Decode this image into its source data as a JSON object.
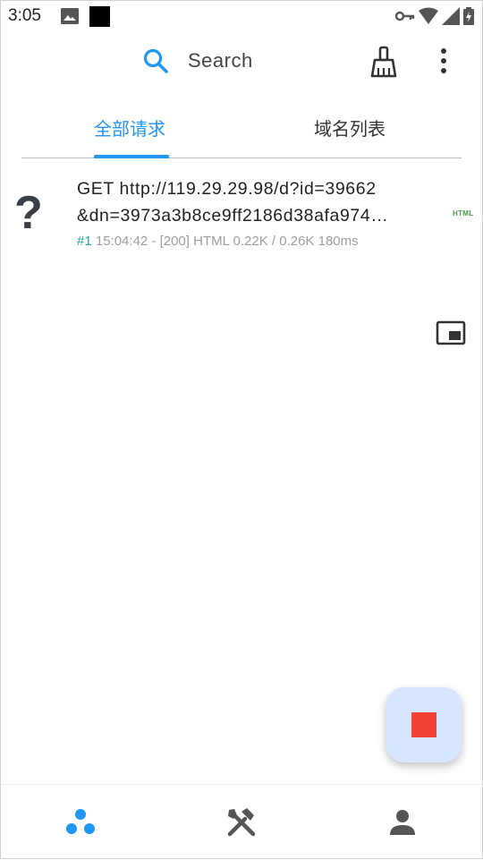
{
  "status_bar": {
    "time": "3:05",
    "icons": [
      "photo-icon",
      "black-square",
      "vpn-key-icon",
      "wifi-icon",
      "signal-icon",
      "battery-icon"
    ]
  },
  "toolbar": {
    "search_placeholder": "Search",
    "icons": [
      "search-icon",
      "broom-icon",
      "more-vert-icon"
    ]
  },
  "tabs": [
    {
      "label": "全部请求",
      "selected": true
    },
    {
      "label": "域名列表",
      "selected": false
    }
  ],
  "requests": [
    {
      "icon": "?",
      "line1": "GET http://119.29.29.98/d?id=39662",
      "line2": "&dn=3973a3b8ce9ff2186d38afa974…",
      "index": "#1",
      "meta": "15:04:42 - [200] HTML 0.22K / 0.26K  180ms",
      "badge": "HTML"
    }
  ],
  "bottom_nav": [
    {
      "name": "requests",
      "icon": "bubbles-icon",
      "active": true
    },
    {
      "name": "tools",
      "icon": "tools-icon",
      "active": false
    },
    {
      "name": "profile",
      "icon": "person-icon",
      "active": false
    }
  ],
  "colors": {
    "accent": "#2196f3",
    "stop": "#f44336",
    "fab_bg": "#d6e6ff",
    "index": "#26a69a",
    "badge": "#43a047"
  }
}
